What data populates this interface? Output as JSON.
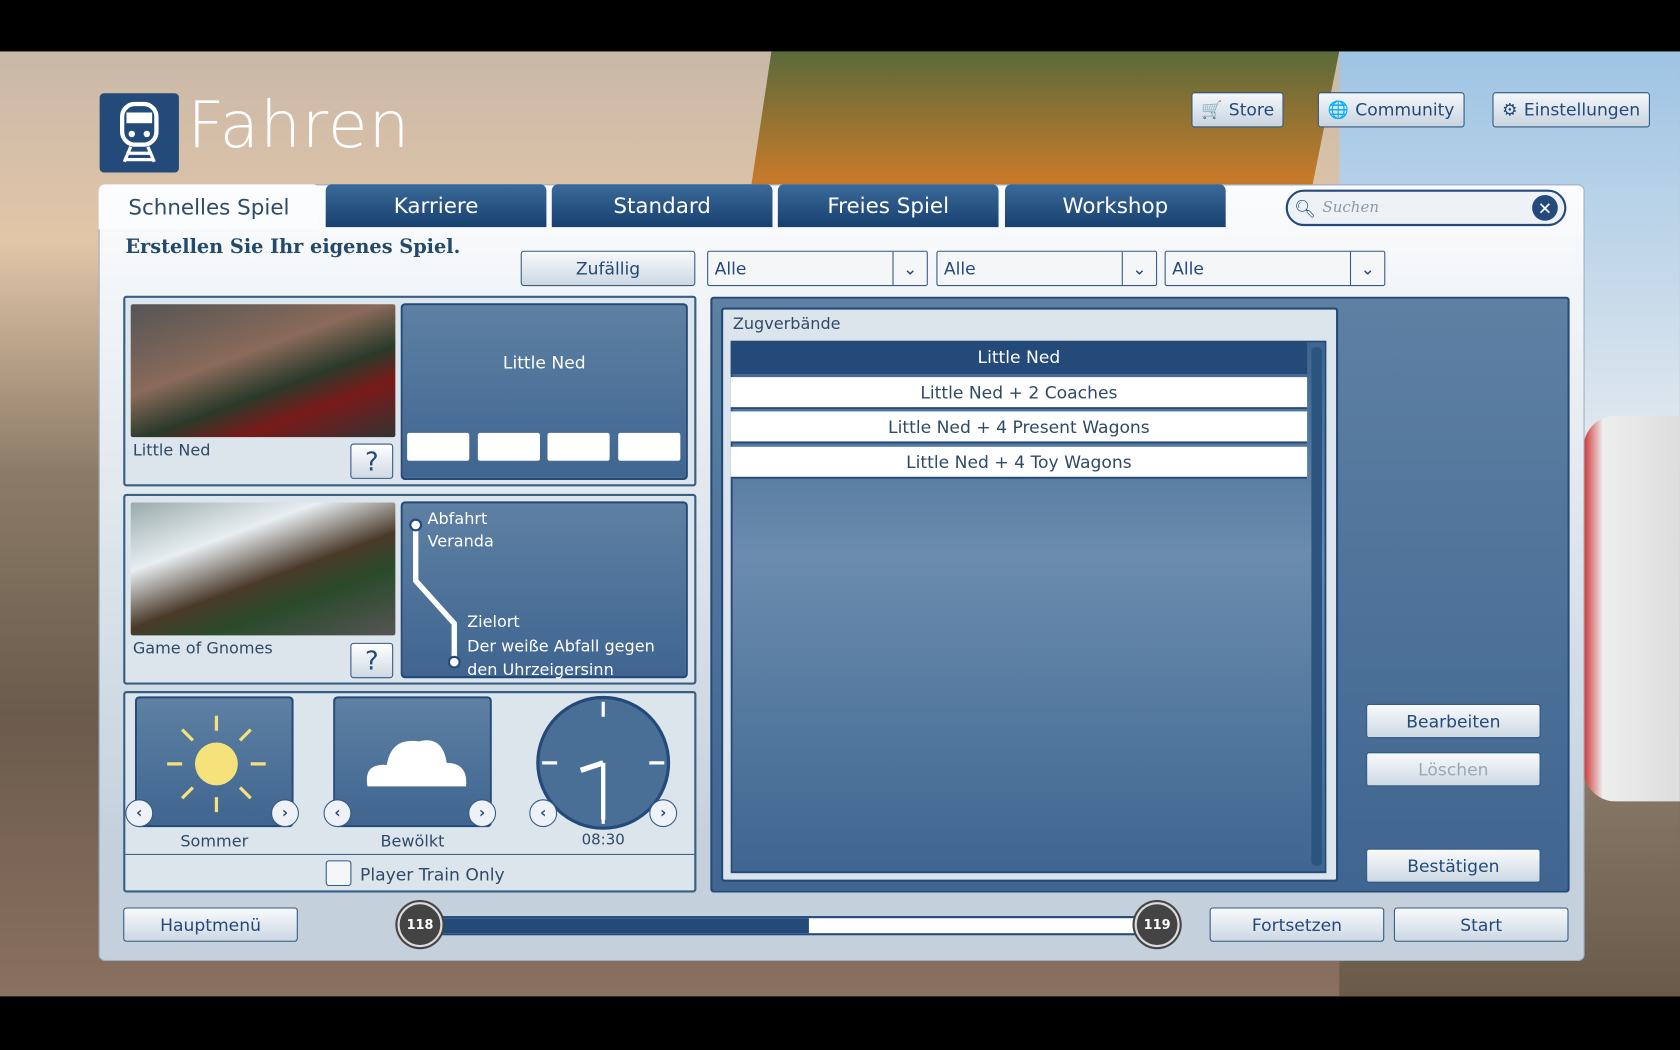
{
  "header": {
    "title": "Fahren",
    "store": "Store",
    "community": "Community",
    "settings": "Einstellungen"
  },
  "tabs": [
    "Schnelles Spiel",
    "Karriere",
    "Standard",
    "Freies Spiel",
    "Workshop"
  ],
  "search": {
    "placeholder": "Suchen"
  },
  "subtitle": "Erstellen Sie Ihr eigenes Spiel.",
  "filters": {
    "random": "Zufällig",
    "selects": [
      "Alle",
      "Alle",
      "Alle"
    ]
  },
  "train": {
    "name": "Little Ned",
    "preview_name": "Little Ned",
    "help": "?"
  },
  "route": {
    "name": "Game of Gnomes",
    "help": "?",
    "departure_label": "Abfahrt",
    "departure": "Veranda",
    "destination_label": "Zielort",
    "destination": "Der weiße Abfall gegen den Uhrzeigersinn"
  },
  "conditions": {
    "season": "Sommer",
    "weather": "Bewölkt",
    "time": "08:30",
    "player_train_only": "Player Train Only",
    "player_train_only_checked": false
  },
  "consists": {
    "title": "Zugverbände",
    "items": [
      "Little Ned",
      "Little Ned + 2 Coaches",
      "Little Ned + 4 Present Wagons",
      "Little Ned + 4 Toy Wagons"
    ],
    "selected": 0
  },
  "actions": {
    "edit": "Bearbeiten",
    "delete": "Löschen",
    "confirm": "Bestätigen"
  },
  "footer": {
    "main_menu": "Hauptmenü",
    "continue": "Fortsetzen",
    "start": "Start",
    "level_current": "118",
    "level_next": "119",
    "level_progress": 0.53
  },
  "colors": {
    "accent": "#244a7a"
  }
}
